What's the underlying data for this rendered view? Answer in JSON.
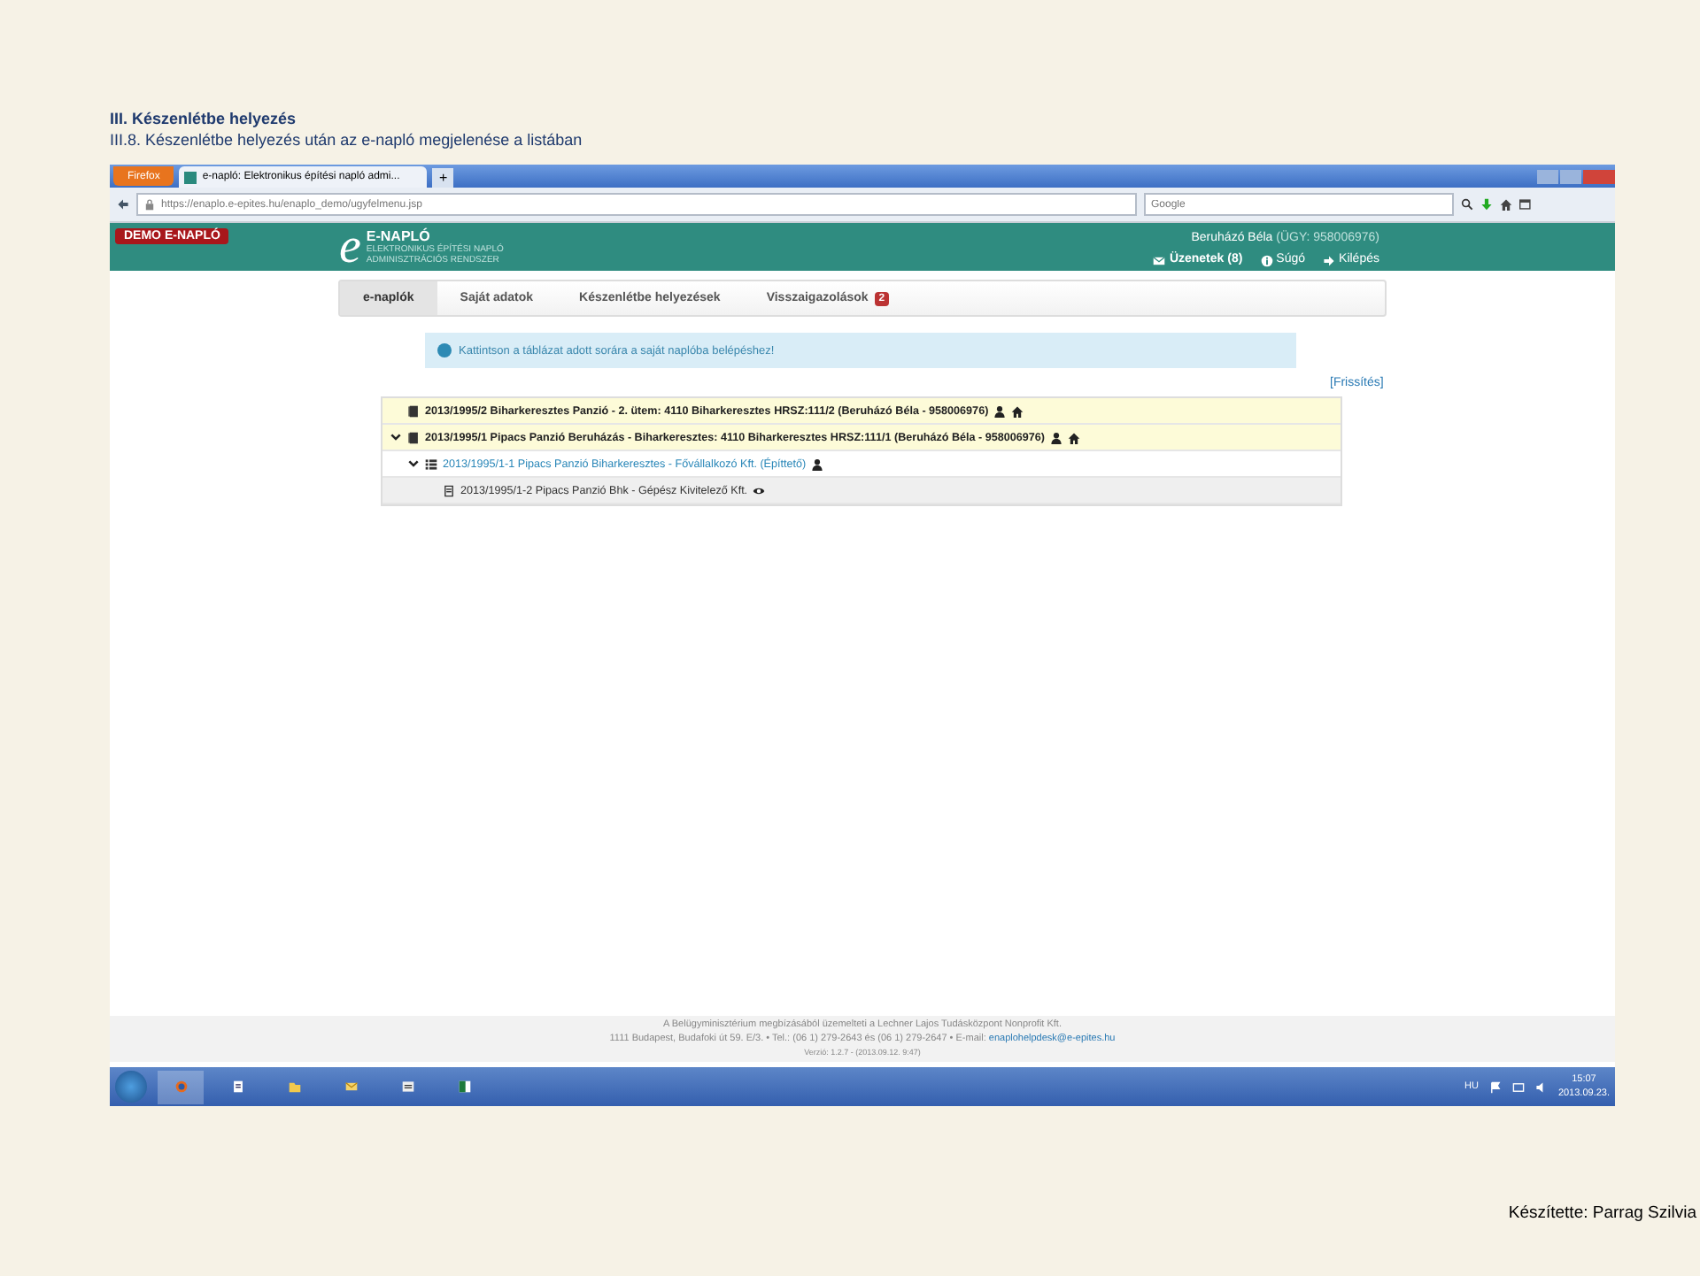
{
  "document": {
    "heading": "III. Készenlétbe helyezés",
    "subheading": "III.8. Készenlétbe helyezés után az e-napló megjelenése a listában",
    "author": "Készítette: Parrag Szilvia"
  },
  "browser": {
    "menu_button": "Firefox",
    "tab_title": "e-napló: Elektronikus építési napló admi...",
    "new_tab": "+",
    "url": "https://enaplo.e-epites.hu/enaplo_demo/ugyfelmenu.jsp",
    "search_placeholder": "Google"
  },
  "app_header": {
    "demo_badge": "DEMO E-NAPLÓ",
    "logo_letter": "e",
    "logo_title": "E-NAPLÓ",
    "logo_subtitle_1": "ELEKTRONIKUS ÉPÍTÉSI NAPLÓ",
    "logo_subtitle_2": "ADMINISZTRÁCIÓS RENDSZER",
    "user": "Beruházó Béla",
    "user_id": "(ÜGY: 958006976)",
    "links": [
      {
        "kind": "messages",
        "label": "Üzenetek (8)"
      },
      {
        "kind": "help",
        "label": "Súgó"
      },
      {
        "kind": "logout",
        "label": "Kilépés"
      }
    ]
  },
  "tabs": [
    {
      "label": "e-naplók",
      "selected": true
    },
    {
      "label": "Saját adatok",
      "selected": false
    },
    {
      "label": "Készenlétbe helyezések",
      "selected": false
    },
    {
      "label": "Visszaigazolások",
      "selected": false,
      "badge": "2"
    }
  ],
  "info": "Kattintson a táblázat adott sorára a saját naplóba belépéshez!",
  "refresh": "[Frissítés]",
  "tree": [
    {
      "kind": "project",
      "text": "2013/1995/2 Biharkeresztes Panzió - 2. ütem: 4110 Biharkeresztes HRSZ:111/2 (Beruházó Béla - 958006976)"
    },
    {
      "kind": "project",
      "text": "2013/1995/1 Pipacs Panzió Beruházás - Biharkeresztes: 4110 Biharkeresztes HRSZ:111/1 (Beruházó Béla - 958006976)",
      "expanded": true,
      "children": [
        {
          "kind": "contract",
          "text": "2013/1995/1-1 Pipacs Panzió Biharkeresztes - Fővállalkozó Kft. (Építtető)",
          "expanded": true,
          "children": [
            {
              "kind": "subcontract",
              "text": "2013/1995/1-2 Pipacs Panzió Bhk - Gépész Kivitelező Kft."
            }
          ]
        }
      ]
    }
  ],
  "footer": {
    "line_1": "A Belügyminisztérium megbízásából üzemelteti a Lechner Lajos Tudásközpont Nonprofit Kft.",
    "line_2": "1111 Budapest, Budafoki út 59. E/3. • Tel.: (06 1) 279-2643 és (06 1) 279-2647 • E-mail:",
    "email": "enaplohelpdesk@e-epites.hu",
    "version": "Verzió: 1.2.7 - (2013.09.12. 9:47)"
  },
  "taskbar": {
    "language": "HU",
    "time": "15:07",
    "date": "2013.09.23."
  }
}
